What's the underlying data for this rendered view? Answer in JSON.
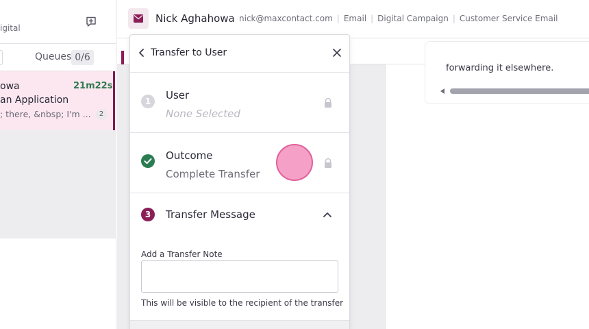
{
  "left_panel": {
    "subtitle_partial": "igital",
    "tabs": {
      "queues_label": "Queues",
      "queues_count": "0/6"
    },
    "conversation": {
      "name_partial": "owa",
      "elapsed": "21m22s",
      "subject_partial": "an Application",
      "preview_partial": "; there, &nbsp; I'm ...",
      "message_count": "2"
    }
  },
  "header": {
    "contact_name": "Nick Aghahowa",
    "email": "nick@maxcontact.com",
    "channel": "Email",
    "campaign": "Digital Campaign",
    "queue": "Customer Service Email",
    "separator": "|"
  },
  "email_preview": {
    "text": "forwarding it elsewhere."
  },
  "transfer_panel": {
    "title": "Transfer to User",
    "steps": [
      {
        "number": "1",
        "title": "User",
        "value": "None Selected",
        "state": "locked"
      },
      {
        "number": "✓",
        "title": "Outcome",
        "value": "Complete Transfer",
        "state": "complete"
      },
      {
        "number": "3",
        "title": "Transfer Message",
        "state": "expanded"
      }
    ],
    "note_label": "Add a Transfer Note",
    "note_value": "",
    "note_help": "This will be visible to the recipient of the transfer"
  },
  "colors": {
    "accent": "#8a1f57",
    "success": "#2a7d53",
    "selected_bg": "#fce7f0",
    "click_indicator": "#f180b4"
  }
}
